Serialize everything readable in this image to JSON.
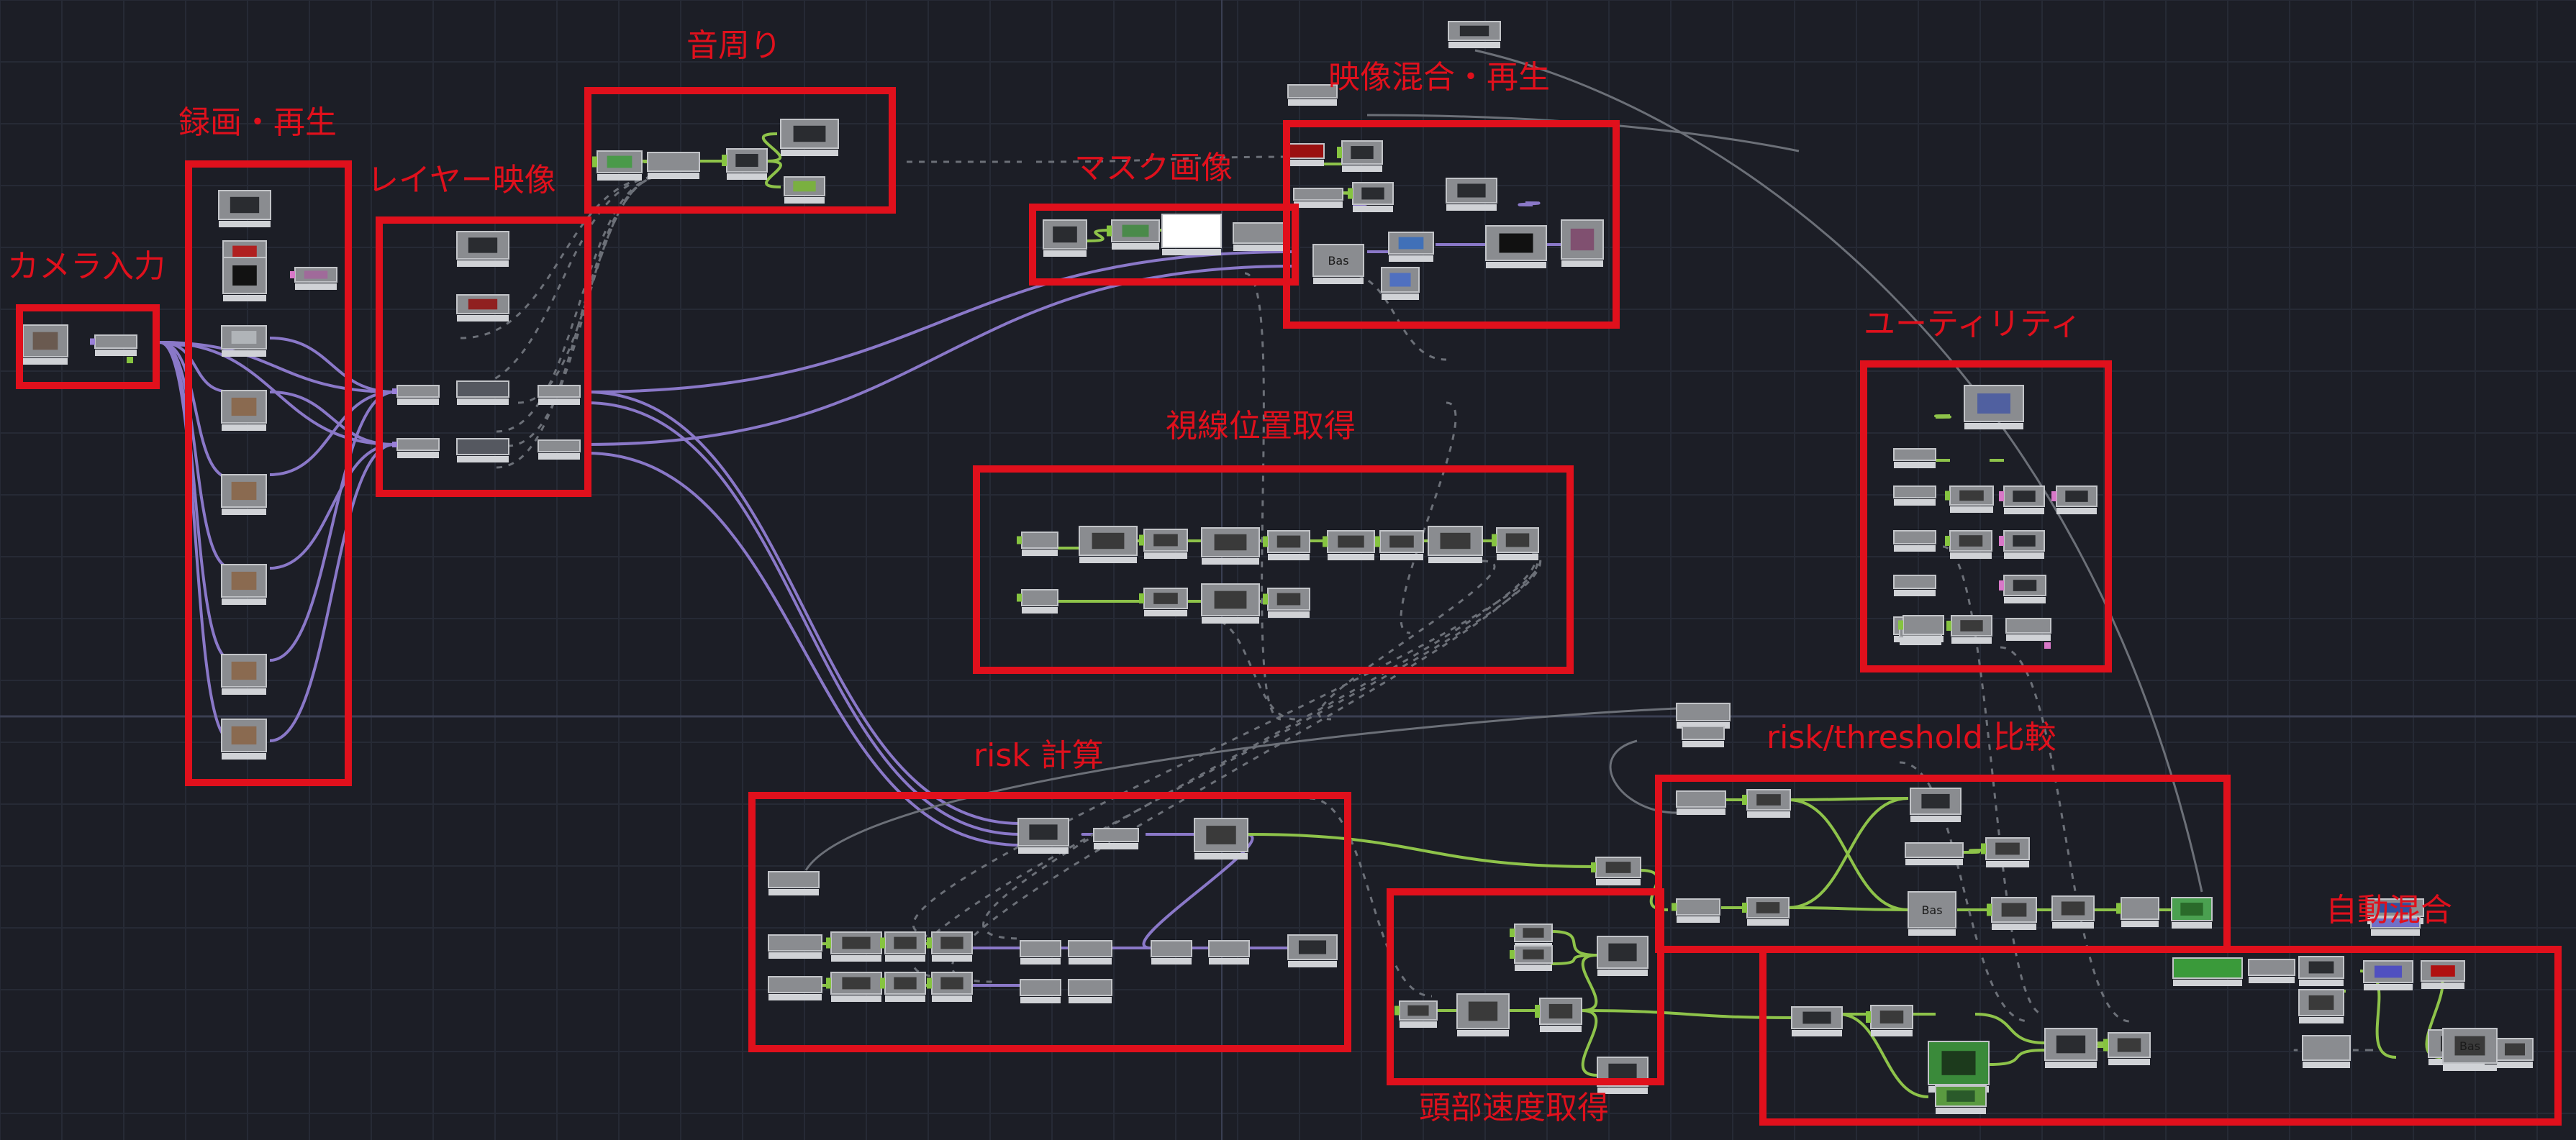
{
  "colors": {
    "background": "#1c1e26",
    "grid": "#262a35",
    "axis": "#3a3f52",
    "annotation_red": "#e0101c",
    "wire_purple": "#8a78c8",
    "wire_green": "#8ec34a",
    "wire_gray": "#6c7078",
    "node_fill": "#8a8c90",
    "node_border": "#c2c4c8",
    "node_dark": "#2a2c30",
    "port_green": "#86c440",
    "port_purple": "#9a80d8",
    "port_pink": "#d878c8"
  },
  "groups": [
    {
      "id": "camera",
      "label": "カメラ入力"
    },
    {
      "id": "record",
      "label": "録画・再生"
    },
    {
      "id": "layer",
      "label": "レイヤー映像"
    },
    {
      "id": "audio",
      "label": "音周り"
    },
    {
      "id": "mask",
      "label": "マスク画像"
    },
    {
      "id": "mix",
      "label": "映像混合・再生"
    },
    {
      "id": "utility",
      "label": "ユーティリティ"
    },
    {
      "id": "gaze",
      "label": "視線位置取得"
    },
    {
      "id": "risk",
      "label": "risk 計算"
    },
    {
      "id": "compare",
      "label": "risk/threshold 比較"
    },
    {
      "id": "head",
      "label": "頭部速度取得"
    },
    {
      "id": "auto",
      "label": "自動混合"
    }
  ],
  "node_texts": {
    "bas1": "Bas",
    "bas2": "Bas",
    "bas3": "Bas"
  }
}
